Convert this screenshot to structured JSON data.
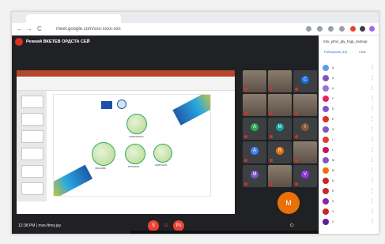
{
  "browser": {
    "url": "meet.google.com/xxx-xxxx-xxx",
    "nav_back": "←",
    "nav_forward": "→",
    "nav_reload": "C",
    "toolbar_icon_colors": [
      "#9aa0a6",
      "#9aa0a6",
      "#9aa0a6",
      "#9aa0a6",
      "#e94235",
      "#3c4043",
      "#9e69e6"
    ]
  },
  "meeting": {
    "presenter_label": "Ревний ВКЕТЕВ ОРДСТА СЕЙ",
    "info": "12:38 PM  |  mxs-ftmq-jay",
    "participant_badge": "M"
  },
  "slide": {
    "labels": [
      "CORONAVIRUS",
      "INFLUENZA",
      "ROTAVIRUS",
      "NOROVIRUS"
    ],
    "colors": {
      "eu_blue": "#1f4fa8",
      "stripe_blue": "#1e5aa8",
      "stripe_cyan": "#28a7e0",
      "stripe_yellow": "#ffd200"
    }
  },
  "tiles": [
    {
      "kind": "photo"
    },
    {
      "kind": "photo"
    },
    {
      "kind": "initial",
      "initial": "C",
      "color": "#1a73e8"
    },
    {
      "kind": "photo"
    },
    {
      "kind": "photo"
    },
    {
      "kind": "photo"
    },
    {
      "kind": "initial",
      "initial": "A",
      "color": "#34a853"
    },
    {
      "kind": "initial",
      "initial": "M",
      "color": "#12a0a4"
    },
    {
      "kind": "initial",
      "initial": "I",
      "color": "#8d5a3b"
    },
    {
      "kind": "initial",
      "initial": "A",
      "color": "#4285f4"
    },
    {
      "kind": "initial",
      "initial": "R",
      "color": "#e8710a"
    },
    {
      "kind": "photo"
    },
    {
      "kind": "initial",
      "initial": "M",
      "color": "#7e57c2"
    },
    {
      "kind": "photo"
    },
    {
      "kind": "initial",
      "initial": "V",
      "color": "#9334e6"
    }
  ],
  "panel": {
    "title": "mtx_ytmx_jdy_fsqp_ssdoop",
    "tab_people": "Participants (16)",
    "tab_chat": "Chat",
    "participants": [
      {
        "initial": "A",
        "color": "#5e97f6"
      },
      {
        "initial": "A",
        "color": "#7e57c2"
      },
      {
        "initial": "A",
        "color": "#9575cd"
      },
      {
        "initial": "C",
        "color": "#e91e63"
      },
      {
        "initial": "D",
        "color": "#7e57c2"
      },
      {
        "initial": "E",
        "color": "#d93025"
      },
      {
        "initial": "G",
        "color": "#7e57c2"
      },
      {
        "initial": "I",
        "color": "#e53935"
      },
      {
        "initial": "L",
        "color": "#c2185b"
      },
      {
        "initial": "M",
        "color": "#7e57c2"
      },
      {
        "initial": "M",
        "color": "#e8710a"
      },
      {
        "initial": "N",
        "color": "#c62828"
      },
      {
        "initial": "R",
        "color": "#c62828"
      },
      {
        "initial": "S",
        "color": "#8e24aa"
      },
      {
        "initial": "V",
        "color": "#c62828"
      },
      {
        "initial": "Z",
        "color": "#6a1b9a"
      }
    ]
  },
  "controls": {
    "mic_label": "S",
    "hangup_label": "⏻",
    "cam_label": "Ps",
    "captions_label": "C↑"
  }
}
